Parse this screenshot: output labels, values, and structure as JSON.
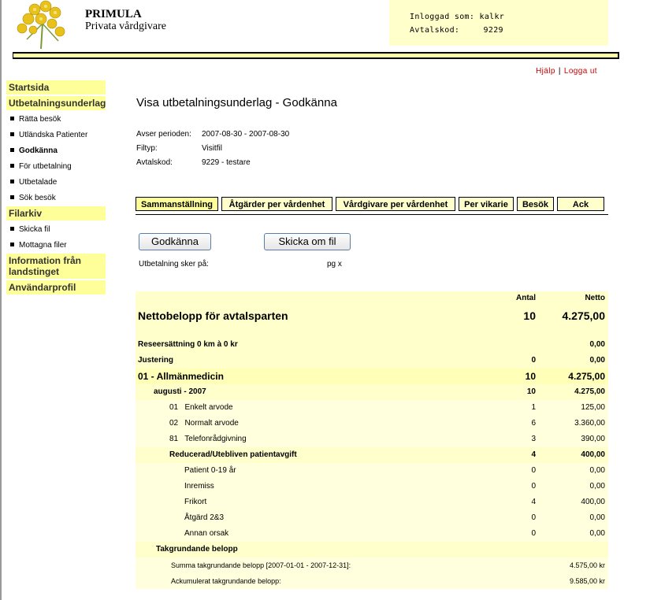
{
  "header": {
    "brand_title": "PRIMULA",
    "brand_subtitle": "Privata vårdgivare",
    "user_label": "Inloggad som:",
    "user_value": "kalkr",
    "avtal_label": "Avtalskod:",
    "avtal_value": "9229"
  },
  "toplinks": {
    "help": "Hjälp",
    "logout": "Logga ut"
  },
  "sidebar": {
    "sections": [
      {
        "head": "Startsida",
        "items": []
      },
      {
        "head": "Utbetalningsunderlag",
        "items": [
          "Rätta besök",
          "Utländska Patienter",
          "Godkänna",
          "För utbetalning",
          "Utbetalade",
          "Sök besök"
        ]
      },
      {
        "head": "Filarkiv",
        "items": [
          "Skicka fil",
          "Mottagna filer"
        ]
      },
      {
        "head": "Information från landstinget",
        "items": []
      },
      {
        "head": "Användarprofil",
        "items": []
      }
    ],
    "active_item": "Godkänna"
  },
  "main": {
    "title": "Visa utbetalningsunderlag - Godkänna",
    "meta": [
      {
        "key": "Avser perioden:",
        "value": "2007-08-30 - 2007-08-30"
      },
      {
        "key": "Filtyp:",
        "value": "Visitfil"
      },
      {
        "key": "Avtalskod:",
        "value": "9229 - testare"
      }
    ],
    "tabs": [
      "Sammanställning",
      "Åtgärder per vårdenhet",
      "Vårdgivare per vårdenhet",
      "Per vikarie",
      "Besök",
      "Ack"
    ],
    "approve_button": "Godkänna",
    "resend_button": "Skicka om fil",
    "payment_label": "Utbetalning sker på:",
    "payment_value": "pg x"
  },
  "table": {
    "col_antal": "Antal",
    "col_netto": "Netto",
    "rows": [
      {
        "label": "Nettobelopp för avtalsparten",
        "antal": "10",
        "netto": "4.275,00"
      },
      {
        "label": "Reseersättning 0 km à 0 kr",
        "antal": "",
        "netto": "0,00"
      },
      {
        "label": "Justering",
        "antal": "0",
        "netto": "0,00"
      },
      {
        "label": "01 - Allmänmedicin",
        "antal": "10",
        "netto": "4.275,00"
      },
      {
        "label": "augusti - 2007",
        "antal": "10",
        "netto": "4.275,00"
      },
      {
        "label": "01   Enkelt arvode",
        "antal": "1",
        "netto": "125,00"
      },
      {
        "label": "02   Normalt arvode",
        "antal": "6",
        "netto": "3.360,00"
      },
      {
        "label": "81   Telefonrådgivning",
        "antal": "3",
        "netto": "390,00"
      },
      {
        "label": "Reducerad/Utebliven patientavgift",
        "antal": "4",
        "netto": "400,00"
      },
      {
        "label": "Patient 0-19 år",
        "antal": "0",
        "netto": "0,00"
      },
      {
        "label": "Inremiss",
        "antal": "0",
        "netto": "0,00"
      },
      {
        "label": "Frikort",
        "antal": "4",
        "netto": "400,00"
      },
      {
        "label": "Åtgärd 2&3",
        "antal": "0",
        "netto": "0,00"
      },
      {
        "label": "Annan orsak",
        "antal": "0",
        "netto": "0,00"
      },
      {
        "label": "Takgrundande belopp",
        "antal": "",
        "netto": ""
      },
      {
        "label": "Summa takgrundande belopp [2007-01-01 - 2007-12-31]:",
        "antal": "",
        "netto": "4.575,00 kr"
      },
      {
        "label": "Ackumulerat takgrundande belopp:",
        "antal": "",
        "netto": "9.585,00 kr"
      }
    ]
  }
}
